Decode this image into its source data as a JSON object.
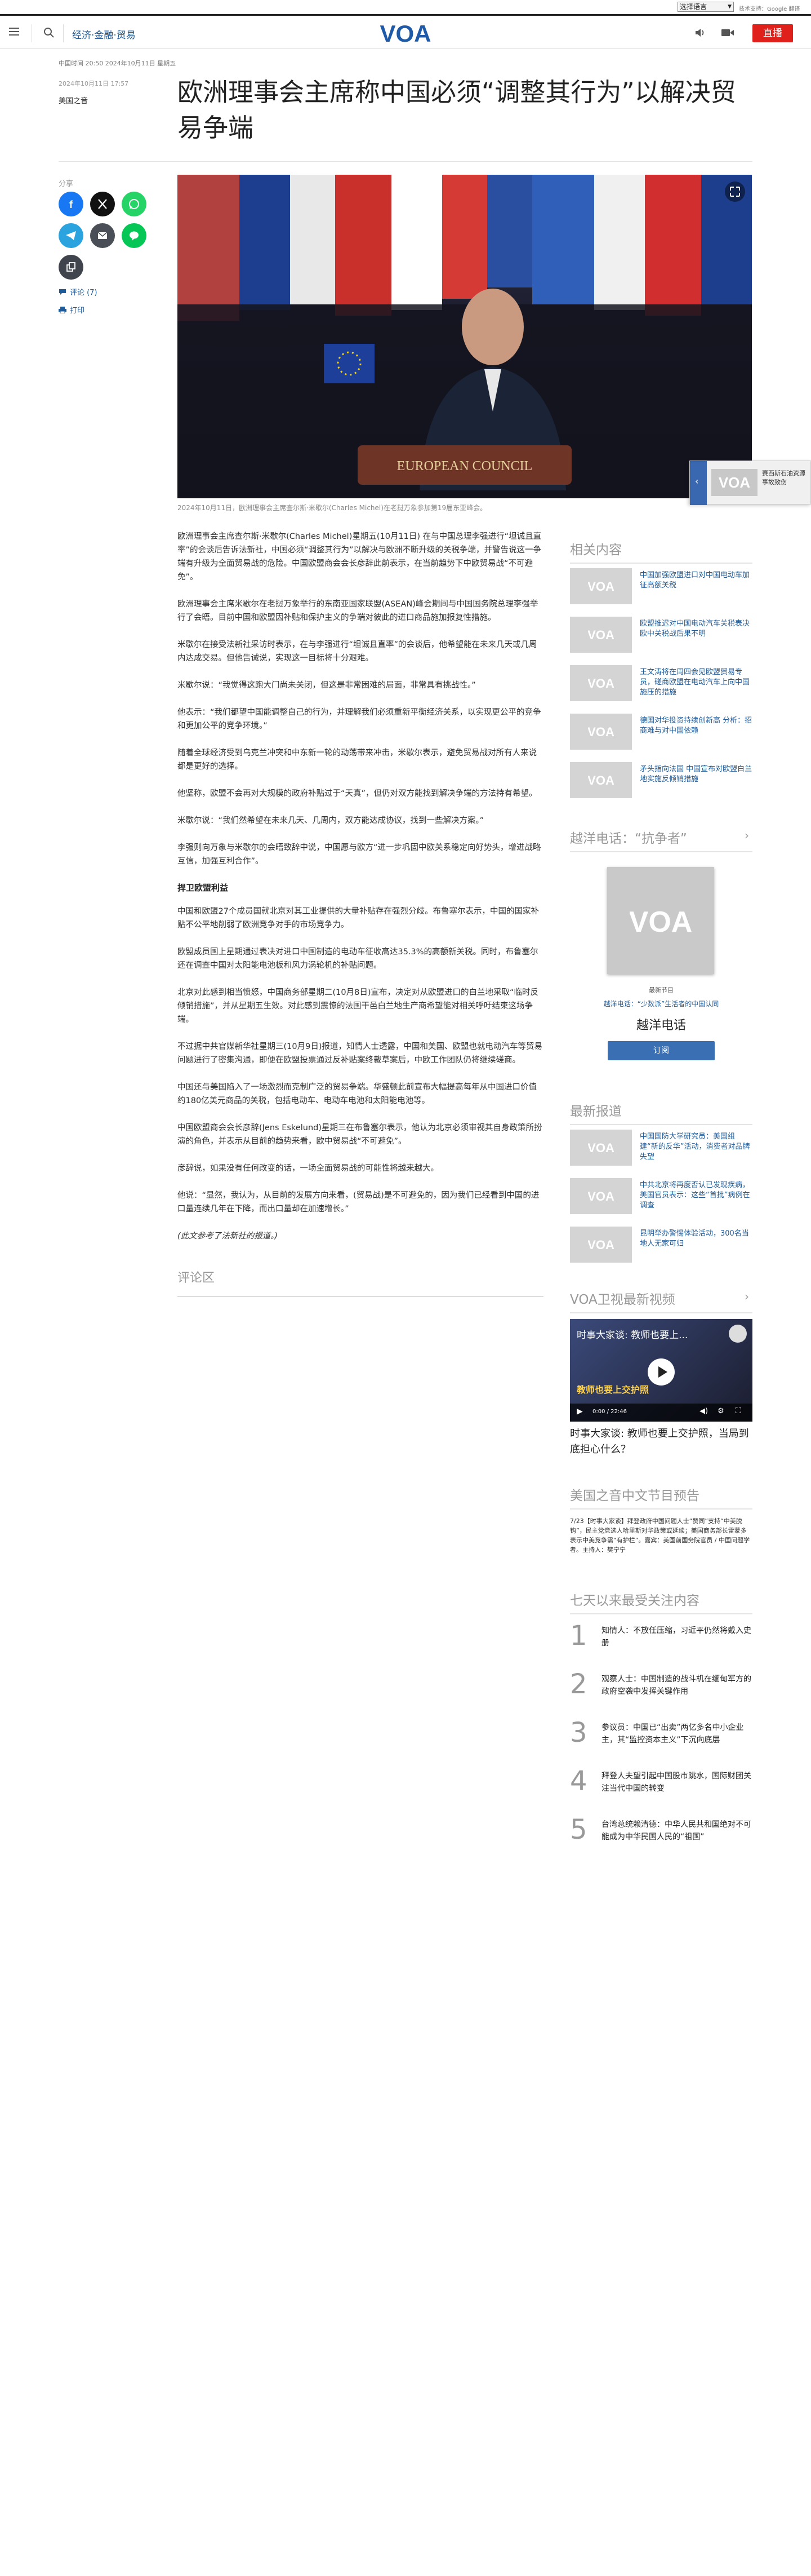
{
  "lang_bar": {
    "select_label": "选择语言",
    "powered_by": "技术支持：Google 翻译"
  },
  "header": {
    "section": "经济·金融·贸易",
    "live_label": "直播"
  },
  "article_meta": {
    "top_line": "中国时间 20:50 2024年10月11日 星期五",
    "date": "2024年10月11日 17:57",
    "category": "美国之音"
  },
  "headline": "欧洲理事会主席称中国必须“调整其行为”以解决贸易争端",
  "share": {
    "label": "分享",
    "comments": "评论 (7)",
    "print": "打印"
  },
  "hero": {
    "caption": "2024年10月11日，欧洲理事会主席查尔斯·米歇尔(Charles Michel)在老挝万象参加第19届东亚峰会。",
    "placard_text": "EUROPEAN COUNCIL"
  },
  "body": [
    "欧洲理事会主席查尔斯·米歇尔(Charles Michel)星期五(10月11日) 在与中国总理李强进行“坦诚且直率”的会谈后告诉法新社，中国必须“调整其行为”以解决与欧洲不断升级的关税争端，并警告说这一争端有升级为全面贸易战的危险。中国欧盟商会会长彦辞此前表示，在当前趋势下中欧贸易战“不可避免”。",
    "欧洲理事会主席米歇尔在老挝万象举行的东南亚国家联盟(ASEAN)峰会期间与中国国务院总理李强举行了会晤。目前中国和欧盟因补贴和保护主义的争端对彼此的进口商品施加报复性措施。",
    "米歇尔在接受法新社采访时表示，在与李强进行“坦诚且直率”的会谈后，他希望能在未来几天或几周内达成交易。但他告诫说，实现这一目标将十分艰难。",
    "米歇尔说：“我觉得这跑大门尚未关闭，但这是非常困难的局面，非常具有挑战性。”",
    "他表示：“我们都望中国能调整自己的行为，并理解我们必须重新平衡经济关系，以实现更公平的竞争和更加公平的竞争环境。”",
    "随着全球经济受到乌克兰冲突和中东新一轮的动荡带来冲击，米歇尔表示，避免贸易战对所有人来说都是更好的选择。",
    "他坚称，欧盟不会再对大规模的政府补贴过于“天真”，但仍对双方能找到解决争端的方法持有希望。",
    "米歇尔说：“我们然希望在未来几天、几周内，双方能达成协议，找到一些解决方案。”",
    "李强则向万象与米歇尔的会晤致辞中说，中国愿与欧方“进一步巩固中欧关系稳定向好势头，增进战略互信，加强互利合作”。",
    "中国和欧盟27个成员国就北京对其工业提供的大量补贴存在强烈分歧。布鲁塞尔表示，中国的国家补贴不公平地削弱了欧洲竞争对手的市场竞争力。",
    "欧盟成员国上星期通过表决对进口中国制造的电动车征收高达35.3%的高额新关税。同时，布鲁塞尔还在调查中国对太阳能电池板和风力涡轮机的补贴问题。",
    "北京对此感到相当愤怒，中国商务部星期二(10月8日)宣布，决定对从欧盟进口的白兰地采取“临时反倾销措施”，并从星期五生效。对此感到震惊的法国干邑白兰地生产商希望能对相关呼吁结束这场争端。",
    "不过据中共官媒新华社星期三(10月9日)报道，知情人士透露，中国和美国、欧盟也就电动汽车等贸易问题进行了密集沟通，即便在欧盟投票通过反补贴案终裁草案后，中欧工作团队仍将继续磋商。",
    "中国还与美国陷入了一场激烈而克制广泛的贸易争端。华盛顿此前宣布大幅提高每年从中国进口价值约180亿美元商品的关税，包括电动车、电动车电池和太阳能电池等。",
    "中国欧盟商会会长彦辞(Jens Eskelund)星期三在布鲁塞尔表示，他认为北京必须审视其自身政策所扮演的角色，并表示从目前的趋势来看，欧中贸易战“不可避免”。",
    "彦辞说，如果没有任何改变的话，一场全面贸易战的可能性将越来越大。",
    "他说：“显然，我认为，从目前的发展方向来看，(贸易战)是不可避免的，因为我们已经看到中国的进口量连续几年在下降，而出口量却在加速增长。”"
  ],
  "subhead": "捍卫欧盟利益",
  "subhead_index": 9,
  "closing_note": "(此文参考了法新社的报道。)",
  "comments_title": "评论区",
  "related": {
    "title": "相关内容",
    "items": [
      "中国加强欧盟进口对中国电动车加征高额关税",
      "欧盟推迟对中国电动汽车关税表决 欧中关税战后果不明",
      "王文涛将在周四会见欧盟贸易专员，磋商欧盟在电动汽车上向中国施压的措施",
      "德国对华投资持续创新高 分析：招商难与对中国依赖",
      "矛头指向法国 中国宣布对欧盟白兰地实施反倾销措施"
    ]
  },
  "podcast": {
    "title": "越洋电话：“抗争者”",
    "latest": "最新节目",
    "sub": "越洋电话：“少数派”生活者的中国认同",
    "name": "越洋电话",
    "subscribe": "订阅"
  },
  "latest_news": {
    "title": "最新报道",
    "items": [
      "中国国防大学研究员：美国组建“新的反华”活动，消费者对品牌失望",
      "中共北京将再度否认已发现疾病，美国官员表示：这些“首批”病例在调查",
      "昆明举办警惕体验活动，300名当地人无家可归"
    ]
  },
  "video": {
    "title": "VOA卫视最新视频",
    "overlay_title": "时事大家谈: 教师也要上...",
    "time": "0:00 / 22:46",
    "banner_text": "教师也要上交护照",
    "caption": "时事大家谈: 教师也要上交护照，当局到底担心什么？"
  },
  "schedule": {
    "title": "美国之音中文节目预告",
    "text": "7/23【时事大家谈】拜登政府中国问题人士“赞同”支持“中美脱钩”，民主党竞选人哈里斯对华政策或延续；美国商务部长雷蒙多表示中美竞争需“有护栏”。嘉宾：美国前国务院官员 / 中国问题学者。主持人：樊宁宁"
  },
  "popular": {
    "title": "七天以来最受关注内容",
    "items": [
      {
        "num": "1",
        "text": "知情人：不放任压缩，习近平仍然将戴入史册"
      },
      {
        "num": "2",
        "text": "观察人士：中国制造的战斗机在缅甸军方的政府空袭中发挥关键作用"
      },
      {
        "num": "3",
        "text": "参议员：中国已“出卖”两亿多名中小企业主，其“监控资本主义”下沉向底层"
      },
      {
        "num": "4",
        "text": "拜登人夫望引起中国股市跳水，国际财团关注当代中国的转变"
      },
      {
        "num": "5",
        "text": "台湾总统赖清德：中华人民共和国绝对不可能成为中华民国人民的“祖国”"
      }
    ]
  },
  "popup": {
    "text": "赛西斯石油资源事故致伤"
  },
  "colors": {
    "brand_blue": "#1f5b99",
    "live_red": "#e0201b",
    "logo_blue": "#1e5aa8"
  }
}
